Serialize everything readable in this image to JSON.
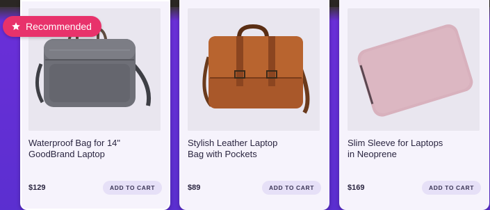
{
  "badge": {
    "label": "Recommended",
    "icon": "star-icon"
  },
  "products": [
    {
      "title_line1": "Waterproof Bag for 14\"",
      "title_line2": "GoodBrand Laptop",
      "price": "$129",
      "cta": "ADD TO CART",
      "image": "grey-laptop-bag-image"
    },
    {
      "title_line1": "Stylish Leather Laptop",
      "title_line2": "Bag with Pockets",
      "price": "$89",
      "cta": "ADD TO CART",
      "image": "brown-leather-bag-image"
    },
    {
      "title_line1": "Slim Sleeve for Laptops",
      "title_line2": "in Neoprene",
      "price": "$169",
      "cta": "ADD TO CART",
      "image": "pink-laptop-sleeve-image"
    }
  ],
  "colors": {
    "accent": "#e8326b",
    "background": "#5b2fd0",
    "card": "#f6f3fc",
    "button": "#e6e0f7"
  }
}
